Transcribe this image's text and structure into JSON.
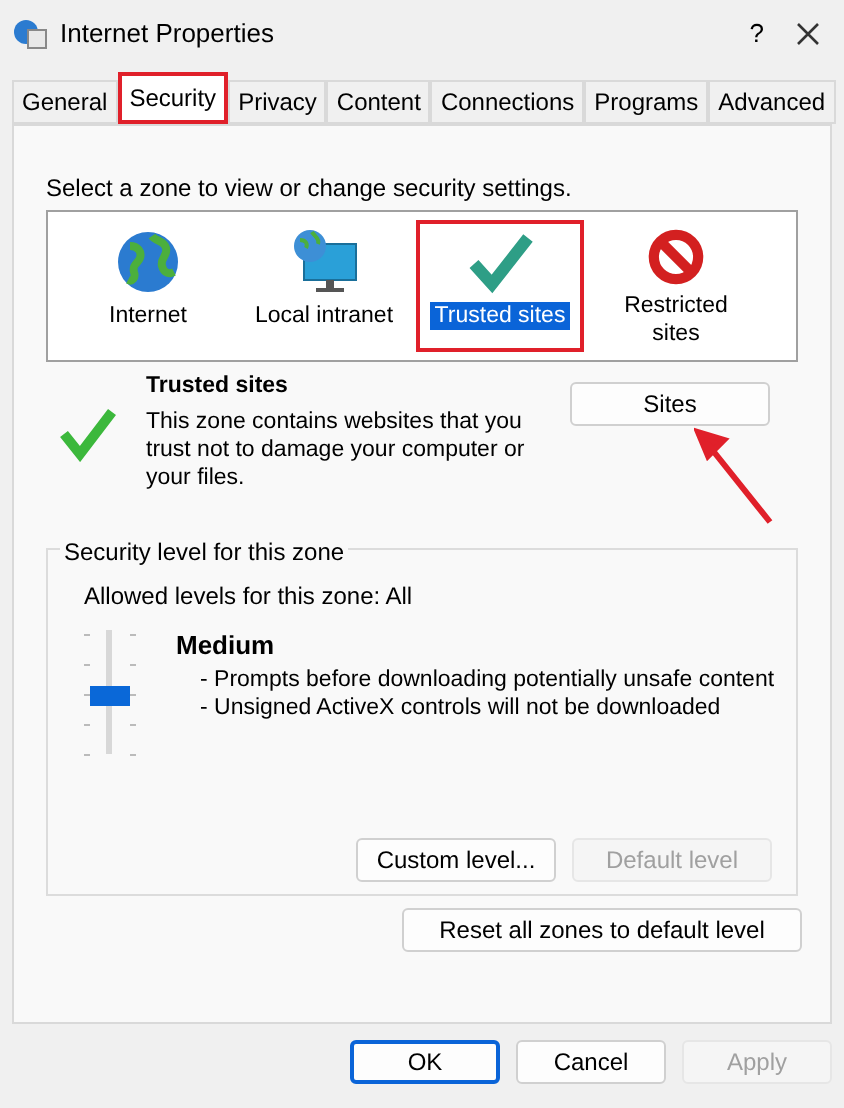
{
  "window": {
    "title": "Internet Properties",
    "help": "?"
  },
  "tabs": [
    {
      "label": "General",
      "selected": false,
      "highlighted": false
    },
    {
      "label": "Security",
      "selected": true,
      "highlighted": true
    },
    {
      "label": "Privacy",
      "selected": false,
      "highlighted": false
    },
    {
      "label": "Content",
      "selected": false,
      "highlighted": false
    },
    {
      "label": "Connections",
      "selected": false,
      "highlighted": false
    },
    {
      "label": "Programs",
      "selected": false,
      "highlighted": false
    },
    {
      "label": "Advanced",
      "selected": false,
      "highlighted": false
    }
  ],
  "zone_prompt": "Select a zone to view or change security settings.",
  "zones": [
    {
      "kind": "internet",
      "label": "Internet",
      "selected": false,
      "highlighted": false
    },
    {
      "kind": "intranet",
      "label": "Local intranet",
      "selected": false,
      "highlighted": false
    },
    {
      "kind": "trusted",
      "label": "Trusted sites",
      "selected": true,
      "highlighted": true
    },
    {
      "kind": "restricted",
      "label": "Restricted sites",
      "selected": false,
      "highlighted": false
    }
  ],
  "zone_info": {
    "title": "Trusted sites",
    "description": "This zone contains websites that you trust not to damage your computer or your files."
  },
  "sites_button": {
    "label": "Sites",
    "pointer_arrow": true
  },
  "security_level": {
    "group_title": "Security level for this zone",
    "allowed": "Allowed levels for this zone: All",
    "level": 0.5,
    "level_name": "Medium",
    "bullets": [
      "- Prompts before downloading potentially unsafe content",
      "- Unsigned ActiveX controls will not be downloaded"
    ],
    "buttons": [
      {
        "label": "Custom level...",
        "disabled": false
      },
      {
        "label": "Default level",
        "disabled": true
      }
    ]
  },
  "reset_button": "Reset all zones to default level",
  "footer_buttons": [
    {
      "label": "OK",
      "default": true,
      "disabled": false
    },
    {
      "label": "Cancel",
      "default": false,
      "disabled": false
    },
    {
      "label": "Apply",
      "default": false,
      "disabled": true
    }
  ]
}
